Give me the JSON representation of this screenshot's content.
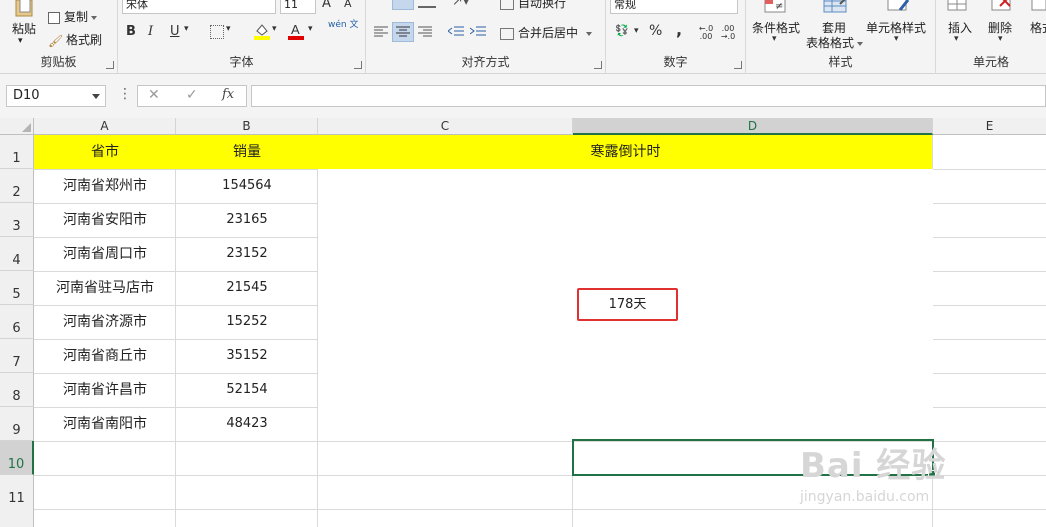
{
  "ribbon": {
    "clipboard": {
      "paste": "粘贴",
      "copy": "复制",
      "format_painter": "格式刷",
      "label": "剪贴板"
    },
    "font": {
      "font_name": "宋体",
      "font_size": "11",
      "bold": "B",
      "italic": "I",
      "underline": "U",
      "label": "字体",
      "grow": "A",
      "shrink": "A",
      "phonetic": "wén 文"
    },
    "alignment": {
      "wrap_text": "自动换行",
      "merge_center": "合并后居中",
      "label": "对齐方式"
    },
    "number": {
      "format": "常规",
      "percent": "%",
      "comma": ",",
      "inc_decimal": "←.0 .00",
      "dec_decimal": ".00 →.0",
      "label": "数字"
    },
    "styles": {
      "conditional": "条件格式",
      "table_line1": "套用",
      "table_line2": "表格格式",
      "cell_styles": "单元格样式",
      "label": "样式"
    },
    "cells": {
      "insert": "插入",
      "delete": "删除",
      "format": "格式",
      "label": "单元格"
    }
  },
  "formula_bar": {
    "name_box": "D10",
    "cancel": "✕",
    "enter": "✓",
    "fx": "fx",
    "value": ""
  },
  "columns": [
    "A",
    "B",
    "C",
    "D",
    "E"
  ],
  "rows": [
    "1",
    "2",
    "3",
    "4",
    "5",
    "6",
    "7",
    "8",
    "9",
    "10",
    "11"
  ],
  "table": {
    "header": {
      "province_city": "省市",
      "sales": "销量",
      "countdown": "寒露倒计时"
    },
    "data": [
      {
        "city": "河南省郑州市",
        "sales": "154564"
      },
      {
        "city": "河南省安阳市",
        "sales": "23165"
      },
      {
        "city": "河南省周口市",
        "sales": "23152"
      },
      {
        "city": "河南省驻马店市",
        "sales": "21545"
      },
      {
        "city": "河南省济源市",
        "sales": "15252"
      },
      {
        "city": "河南省商丘市",
        "sales": "35152"
      },
      {
        "city": "河南省许昌市",
        "sales": "52154"
      },
      {
        "city": "河南省南阳市",
        "sales": "48423"
      }
    ],
    "countdown_value": "178天"
  },
  "watermark": {
    "brand": "Bai 经验",
    "url": "jingyan.baidu.com"
  },
  "colors": {
    "header_fill": "#ffff00",
    "highlight_border": "#e03030",
    "active_green": "#217346"
  }
}
